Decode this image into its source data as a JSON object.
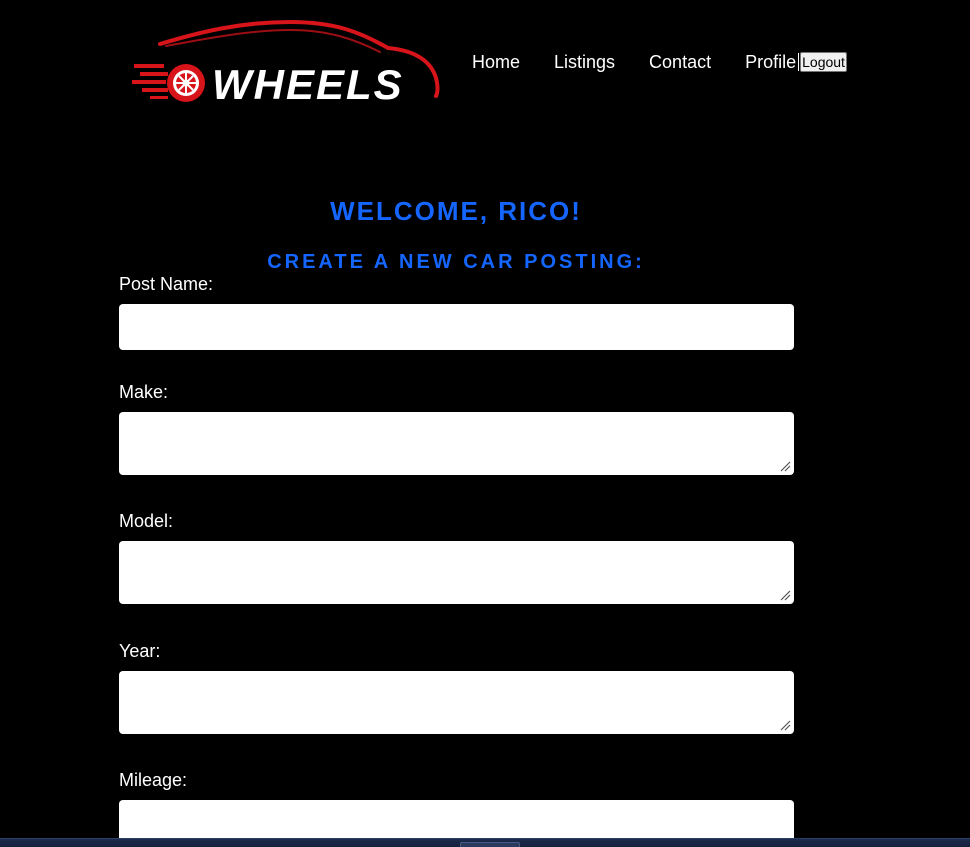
{
  "header": {
    "logo_text": "WHEELS",
    "nav": {
      "home": "Home",
      "listings": "Listings",
      "contact": "Contact",
      "profile": "Profile",
      "logout": "Logout"
    }
  },
  "main": {
    "welcome": "WELCOME, RICO!",
    "subheading": "CREATE A NEW CAR POSTING:",
    "form": {
      "post_name_label": "Post Name:",
      "post_name_value": "",
      "make_label": "Make:",
      "make_value": "",
      "model_label": "Model:",
      "model_value": "",
      "year_label": "Year:",
      "year_value": "",
      "mileage_label": "Mileage:",
      "mileage_value": ""
    }
  },
  "colors": {
    "background": "#000000",
    "accent_blue": "#1565ff",
    "logo_red": "#d8141b",
    "text": "#ffffff"
  },
  "icons": {
    "logo_wheel": "wheel-icon",
    "logo_car": "car-silhouette-icon",
    "resize": "resize-grip-icon"
  }
}
